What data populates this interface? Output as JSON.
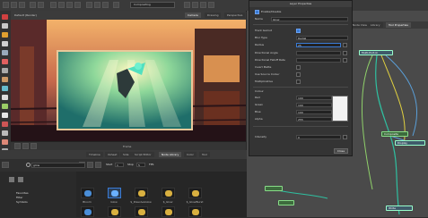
{
  "toolbar": {
    "workspace": "Compositing"
  },
  "viewport": {
    "tabs": [
      "Camera",
      "Drawing",
      "Perspective"
    ],
    "active_tab": "Camera",
    "left_label": "Default (Render)",
    "footer_label": "Frame"
  },
  "library": {
    "tabs": [
      "Timeline",
      "Xsheet",
      "Side",
      "Script Editor",
      "Node Library",
      "Color",
      "Tool"
    ],
    "active_tab": "Node Library",
    "search_value": "glow",
    "tree": [
      "Favorites",
      "Filter",
      "Symbols"
    ],
    "fields": {
      "start_label": "Start",
      "start": "1",
      "stop_label": "Stop",
      "stop": "5",
      "fps_label": "FPS"
    },
    "thumbnails": [
      "Bloom",
      "Glow",
      "$_DissolveGlow",
      "$_Glow",
      "$_GlowBurst"
    ]
  },
  "node_view": {
    "tabs": [
      "Node View",
      "Library",
      "Tool Properties"
    ],
    "nodes": [
      "Write",
      "Multi-Port-In",
      "Display",
      "Composite"
    ]
  },
  "layer_properties": {
    "title": "Layer Properties",
    "enable_label": "Enable/Disable",
    "name_label": "Name",
    "name_value": "Glow",
    "track_drawing_label": "Track Gamut",
    "blur_type_label": "Blur Type",
    "blur_type_value": "Radial",
    "radius_label": "Radius",
    "radius_value": "25",
    "directional_angle_label": "Directional Angle",
    "directional_falloff_label": "Directional Falloff Rate",
    "invert_matte_label": "Invert Matte",
    "use_source_color_label": "Use Source Colour",
    "multiplicative_label": "Multiplicative",
    "colour_section": "Colour",
    "colour_fields": [
      {
        "label": "Red",
        "value": "100"
      },
      {
        "label": "Green",
        "value": "100"
      },
      {
        "label": "Blue",
        "value": "100"
      },
      {
        "label": "Alpha",
        "value": "255"
      }
    ],
    "intensity_label": "Intensity",
    "intensity_value": "0",
    "close_label": "Close"
  },
  "colors": {
    "accent": "#3a7bd5",
    "node_border": "#99ffcc",
    "scene_teal": "#3fb59b",
    "poster_border": "#e8c89a"
  }
}
